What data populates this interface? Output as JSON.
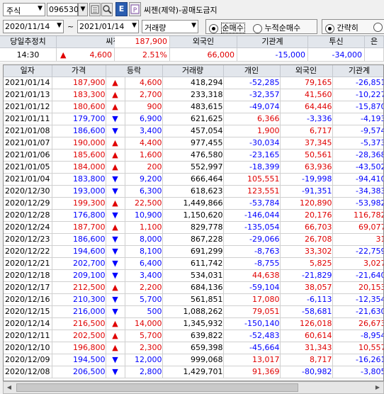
{
  "toolbar": {
    "market": "주식",
    "code": "096530",
    "stock_name": "씨젠(제약)-공매도금지",
    "date_from": "2020/11/14",
    "tilde": "~",
    "date_to": "2021/01/14",
    "metric": "거래량",
    "radio_net": "순매수",
    "radio_cum": "누적순매수",
    "radio_simple": "간략히"
  },
  "summary": {
    "headers": [
      "당일추정치",
      "씨젠",
      "",
      "외국인",
      "기관계",
      "투신",
      "은"
    ],
    "time": "14:30",
    "change": "4,600",
    "price": "187,900",
    "rate": "2.51%",
    "foreign": "66,000",
    "inst": "-15,000",
    "trust": "-34,000"
  },
  "grid": {
    "headers": [
      "일자",
      "가격",
      "등락",
      "거래량",
      "개인",
      "외국인",
      "기관계"
    ],
    "rows": [
      [
        "2021/01/14",
        "187,900",
        "up",
        "4,600",
        "418,294",
        "-52,285",
        "79,165",
        "-26,851"
      ],
      [
        "2021/01/13",
        "183,300",
        "up",
        "2,700",
        "233,318",
        "-32,357",
        "41,560",
        "-10,227"
      ],
      [
        "2021/01/12",
        "180,600",
        "up",
        "900",
        "483,615",
        "-49,074",
        "64,446",
        "-15,870"
      ],
      [
        "2021/01/11",
        "179,700",
        "down",
        "6,900",
        "621,625",
        "6,366",
        "-3,336",
        "-4,193"
      ],
      [
        "2021/01/08",
        "186,600",
        "down",
        "3,400",
        "457,054",
        "1,900",
        "6,717",
        "-9,574"
      ],
      [
        "2021/01/07",
        "190,000",
        "up",
        "4,400",
        "977,455",
        "-30,034",
        "37,345",
        "-5,373"
      ],
      [
        "2021/01/06",
        "185,600",
        "up",
        "1,600",
        "476,580",
        "-23,165",
        "50,561",
        "-28,368"
      ],
      [
        "2021/01/05",
        "184,000",
        "up",
        "200",
        "552,997",
        "-18,399",
        "63,936",
        "-43,502"
      ],
      [
        "2021/01/04",
        "183,800",
        "down",
        "9,200",
        "666,464",
        "105,551",
        "-19,998",
        "-94,410"
      ],
      [
        "2020/12/30",
        "193,000",
        "down",
        "6,300",
        "618,623",
        "123,551",
        "-91,351",
        "-34,383"
      ],
      [
        "2020/12/29",
        "199,300",
        "up",
        "22,500",
        "1,449,866",
        "-53,784",
        "120,890",
        "-53,982"
      ],
      [
        "2020/12/28",
        "176,800",
        "down",
        "10,900",
        "1,150,620",
        "-146,044",
        "20,176",
        "116,782"
      ],
      [
        "2020/12/24",
        "187,700",
        "up",
        "1,100",
        "829,778",
        "-135,054",
        "66,703",
        "69,077"
      ],
      [
        "2020/12/23",
        "186,600",
        "down",
        "8,000",
        "867,228",
        "-29,066",
        "26,708",
        "31"
      ],
      [
        "2020/12/22",
        "194,600",
        "down",
        "8,100",
        "691,299",
        "-8,763",
        "33,302",
        "-22,759"
      ],
      [
        "2020/12/21",
        "202,700",
        "down",
        "6,400",
        "611,742",
        "-8,755",
        "5,825",
        "3,027"
      ],
      [
        "2020/12/18",
        "209,100",
        "down",
        "3,400",
        "534,031",
        "44,638",
        "-21,829",
        "-21,640"
      ],
      [
        "2020/12/17",
        "212,500",
        "up",
        "2,200",
        "684,136",
        "-59,104",
        "38,057",
        "20,153"
      ],
      [
        "2020/12/16",
        "210,300",
        "down",
        "5,700",
        "561,851",
        "17,080",
        "-6,113",
        "-12,354"
      ],
      [
        "2020/12/15",
        "216,000",
        "down",
        "500",
        "1,088,262",
        "79,051",
        "-58,681",
        "-21,630"
      ],
      [
        "2020/12/14",
        "216,500",
        "up",
        "14,000",
        "1,345,932",
        "-150,140",
        "126,018",
        "26,673"
      ],
      [
        "2020/12/11",
        "202,500",
        "up",
        "5,700",
        "639,822",
        "-52,483",
        "60,614",
        "-8,954"
      ],
      [
        "2020/12/10",
        "196,800",
        "up",
        "2,300",
        "659,398",
        "-45,664",
        "31,343",
        "10,557"
      ],
      [
        "2020/12/09",
        "194,500",
        "down",
        "12,000",
        "999,068",
        "13,017",
        "8,717",
        "-16,261"
      ],
      [
        "2020/12/08",
        "206,500",
        "down",
        "2,800",
        "1,429,701",
        "91,369",
        "-80,982",
        "-3,805"
      ]
    ]
  }
}
